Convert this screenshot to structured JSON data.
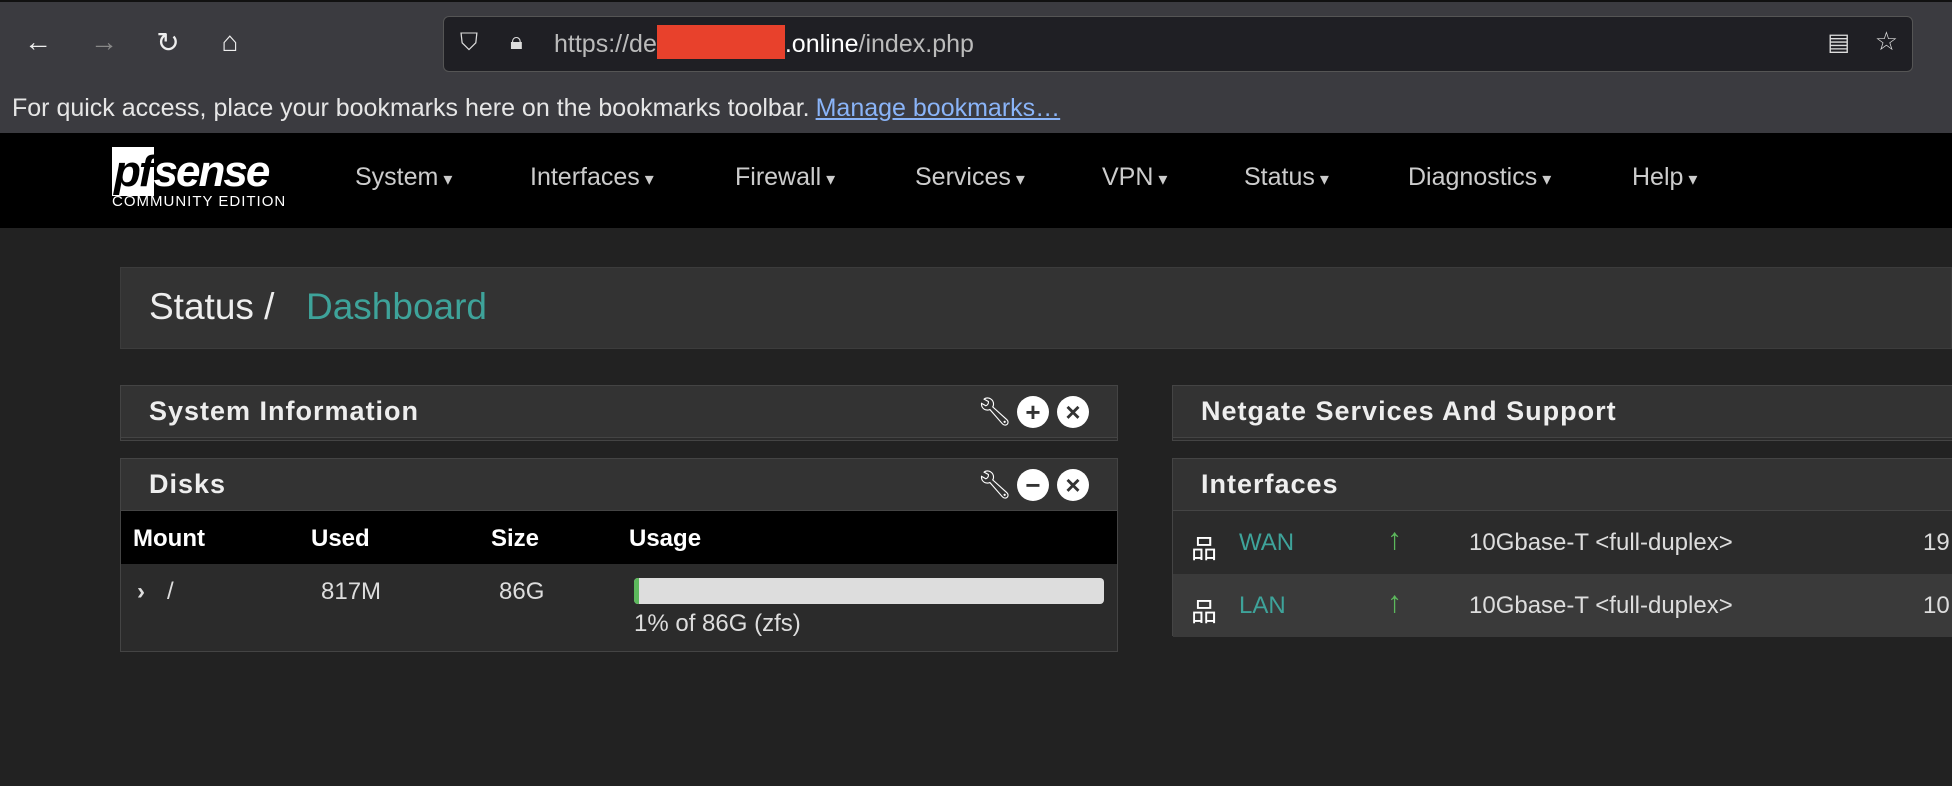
{
  "browser": {
    "url_prefix": "https://de",
    "url_suffix": ".online",
    "url_path": "/index.php",
    "bookmarks_text": "For quick access, place your bookmarks here on the bookmarks toolbar.",
    "manage_bookmarks": "Manage bookmarks…"
  },
  "logo": {
    "text": "pfsense",
    "edition": "COMMUNITY EDITION"
  },
  "menu": [
    "System",
    "Interfaces",
    "Firewall",
    "Services",
    "VPN",
    "Status",
    "Diagnostics",
    "Help"
  ],
  "breadcrumb": {
    "parent": "Status /",
    "current": "Dashboard"
  },
  "panels": {
    "system_info": "System Information",
    "disks": "Disks",
    "netgate": "Netgate Services And Support",
    "interfaces": "Interfaces"
  },
  "disks": {
    "headers": [
      "Mount",
      "Used",
      "Size",
      "Usage"
    ],
    "rows": [
      {
        "mount": "/",
        "used": "817M",
        "size": "86G",
        "usage_percent": 1,
        "usage_text": "1% of 86G (zfs)"
      }
    ]
  },
  "interfaces": [
    {
      "name": "WAN",
      "status": "up",
      "media": "10Gbase-T <full-duplex>",
      "addr": "19"
    },
    {
      "name": "LAN",
      "status": "up",
      "media": "10Gbase-T <full-duplex>",
      "addr": "10"
    }
  ],
  "colors": {
    "accent": "#3ea39a",
    "status_up": "#5cb85c",
    "navbar": "#000000"
  }
}
